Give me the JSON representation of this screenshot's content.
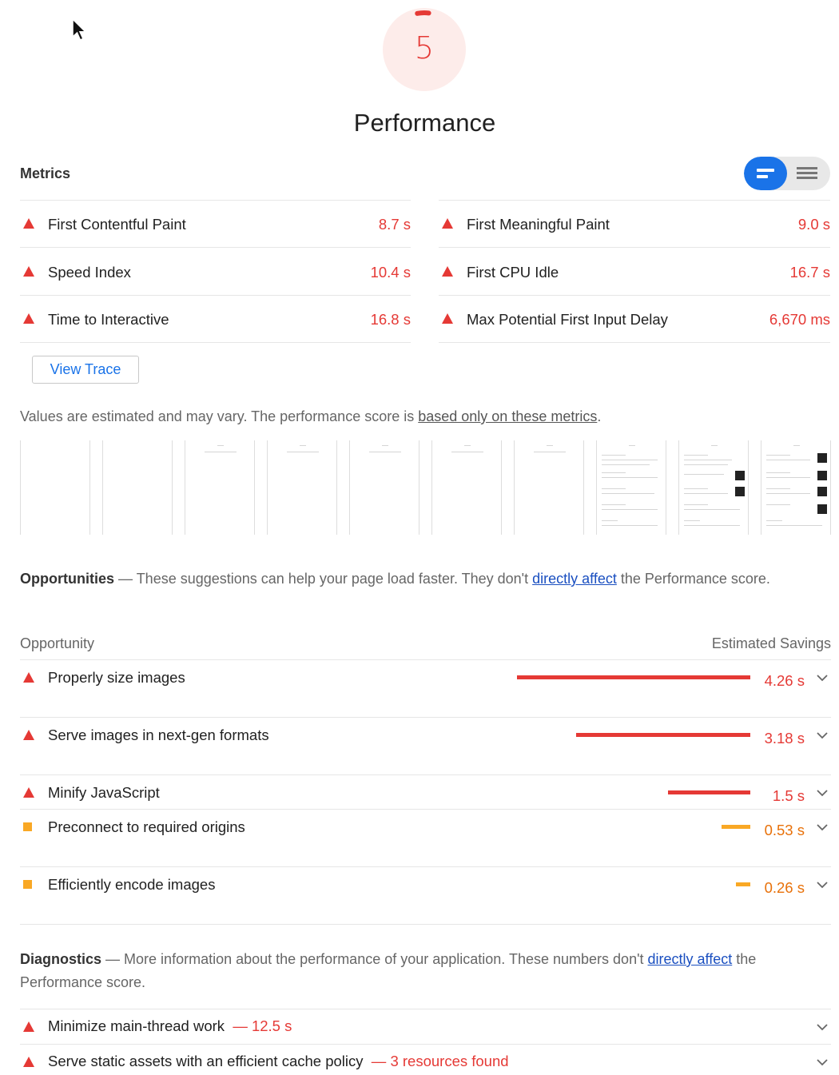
{
  "score": {
    "value": "5",
    "fraction": 0.05,
    "color": "#e53935"
  },
  "category_title": "Performance",
  "metrics": {
    "title": "Metrics",
    "items": [
      {
        "label": "First Contentful Paint",
        "value": "8.7 s"
      },
      {
        "label": "First Meaningful Paint",
        "value": "9.0 s"
      },
      {
        "label": "Speed Index",
        "value": "10.4 s"
      },
      {
        "label": "First CPU Idle",
        "value": "16.7 s"
      },
      {
        "label": "Time to Interactive",
        "value": "16.8 s"
      },
      {
        "label": "Max Potential First Input Delay",
        "value": "6,670 ms"
      }
    ]
  },
  "view_trace_label": "View Trace",
  "estimate_note": {
    "prefix": "Values are estimated and may vary. The performance score is ",
    "link": "based only on these metrics",
    "suffix": "."
  },
  "opportunities": {
    "title": "Opportunities",
    "dash": " — ",
    "desc_prefix": "These suggestions can help your page load faster. They don't ",
    "link": "directly affect",
    "desc_suffix": " the Performance score.",
    "col_left": "Opportunity",
    "col_right": "Estimated Savings",
    "items": [
      {
        "label": "Properly size images",
        "savings": "4.26 s",
        "seconds": 4.26,
        "severity": "fail"
      },
      {
        "label": "Serve images in next-gen formats",
        "savings": "3.18 s",
        "seconds": 3.18,
        "severity": "fail"
      },
      {
        "label": "Minify JavaScript",
        "savings": "1.5 s",
        "seconds": 1.5,
        "severity": "fail"
      },
      {
        "label": "Preconnect to required origins",
        "savings": "0.53 s",
        "seconds": 0.53,
        "severity": "average"
      },
      {
        "label": "Efficiently encode images",
        "savings": "0.26 s",
        "seconds": 0.26,
        "severity": "average"
      }
    ]
  },
  "diagnostics": {
    "title": "Diagnostics",
    "dash": " — ",
    "desc_prefix": "More information about the performance of your application. These numbers don't ",
    "link": "directly affect",
    "desc_suffix": " the Performance score.",
    "items": [
      {
        "label": "Minimize main-thread work",
        "detail": "12.5 s"
      },
      {
        "label": "Serve static assets with an efficient cache policy",
        "detail": "3 resources found"
      }
    ]
  },
  "colors": {
    "fail": "#e53935",
    "average": "#f9a825",
    "accent": "#1a73e8",
    "link": "#1a4fc0"
  },
  "icons": [
    "cursor-icon",
    "fail-triangle-icon",
    "average-square-icon",
    "chevron-down-icon",
    "bar-view-icon",
    "list-view-icon"
  ]
}
